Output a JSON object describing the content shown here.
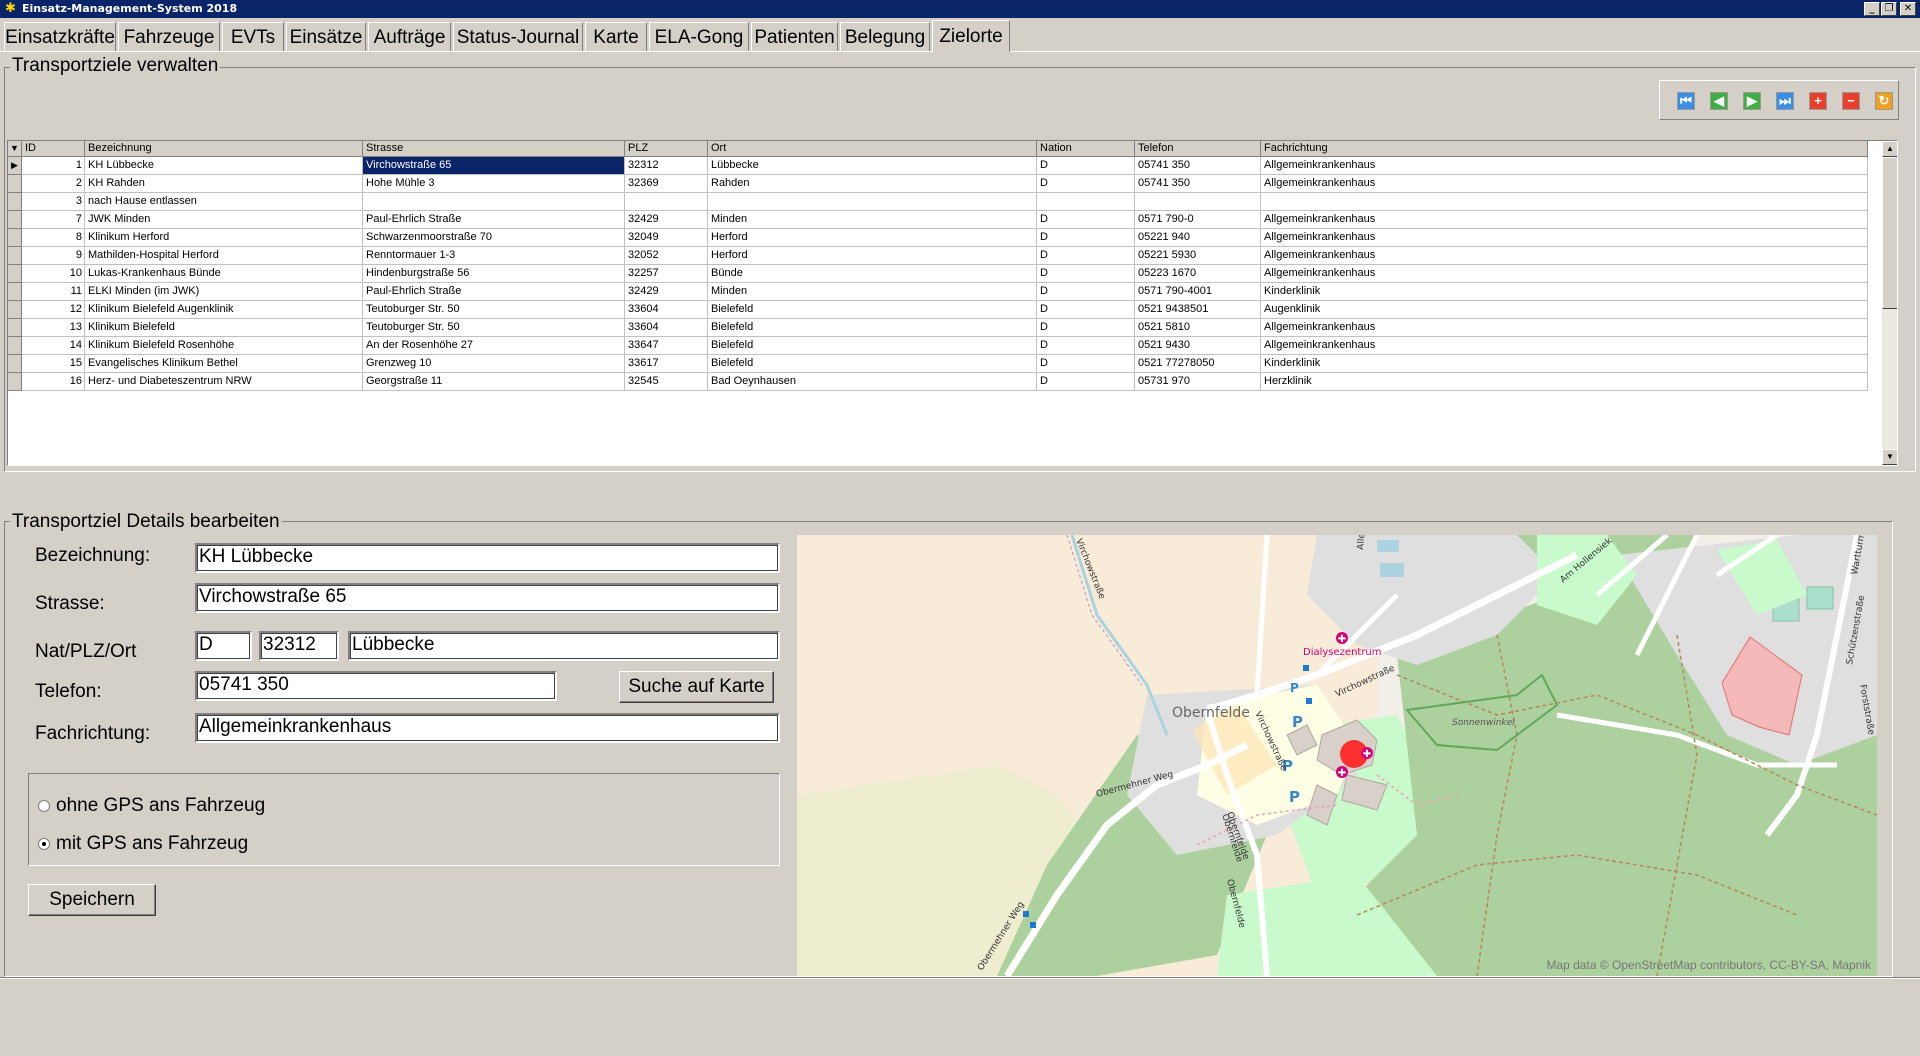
{
  "window": {
    "title": "Einsatz-Management-System 2018"
  },
  "tabs": [
    "Einsatzkräfte",
    "Fahrzeuge",
    "EVTs",
    "Einsätze",
    "Aufträge",
    "Status-Journal",
    "Karte",
    "ELA-Gong",
    "Patienten",
    "Belegung",
    "Zielorte"
  ],
  "active_tab": "Zielorte",
  "list_section": {
    "title": "Transportziele verwalten"
  },
  "grid": {
    "columns": [
      "ID",
      "Bezeichnung",
      "Strasse",
      "PLZ",
      "Ort",
      "Nation",
      "Telefon",
      "Fachrichtung"
    ],
    "rows": [
      {
        "id": "1",
        "name": "KH Lübbecke",
        "street": "Virchowstraße 65",
        "plz": "32312",
        "city": "Lübbecke",
        "nation": "D",
        "phone": "05741 350",
        "dept": "Allgemeinkrankenhaus"
      },
      {
        "id": "2",
        "name": "KH Rahden",
        "street": "Hohe Mühle 3",
        "plz": "32369",
        "city": "Rahden",
        "nation": "D",
        "phone": "05741 350",
        "dept": "Allgemeinkrankenhaus"
      },
      {
        "id": "3",
        "name": "nach Hause entlassen",
        "street": "",
        "plz": "",
        "city": "",
        "nation": "",
        "phone": "",
        "dept": ""
      },
      {
        "id": "7",
        "name": "JWK Minden",
        "street": "Paul-Ehrlich Straße",
        "plz": "32429",
        "city": "Minden",
        "nation": "D",
        "phone": "0571 790-0",
        "dept": "Allgemeinkrankenhaus"
      },
      {
        "id": "8",
        "name": "Klinikum Herford",
        "street": "Schwarzenmoorstraße 70",
        "plz": "32049",
        "city": "Herford",
        "nation": "D",
        "phone": "05221 940",
        "dept": "Allgemeinkrankenhaus"
      },
      {
        "id": "9",
        "name": "Mathilden-Hospital Herford",
        "street": "Renntormauer 1-3",
        "plz": "32052",
        "city": "Herford",
        "nation": "D",
        "phone": "05221 5930",
        "dept": "Allgemeinkrankenhaus"
      },
      {
        "id": "10",
        "name": "Lukas-Krankenhaus Bünde",
        "street": "Hindenburgstraße 56",
        "plz": "32257",
        "city": "Bünde",
        "nation": "D",
        "phone": "05223 1670",
        "dept": "Allgemeinkrankenhaus"
      },
      {
        "id": "11",
        "name": "ELKI Minden (im JWK)",
        "street": "Paul-Ehrlich Straße",
        "plz": "32429",
        "city": "Minden",
        "nation": "D",
        "phone": "0571 790-4001",
        "dept": "Kinderklinik"
      },
      {
        "id": "12",
        "name": "Klinikum Bielefeld Augenklinik",
        "street": "Teutoburger Str. 50",
        "plz": "33604",
        "city": "Bielefeld",
        "nation": "D",
        "phone": "0521 9438501",
        "dept": "Augenklinik"
      },
      {
        "id": "13",
        "name": "Klinikum Bielefeld",
        "street": "Teutoburger Str. 50",
        "plz": "33604",
        "city": "Bielefeld",
        "nation": "D",
        "phone": "0521 5810",
        "dept": "Allgemeinkrankenhaus"
      },
      {
        "id": "14",
        "name": "Klinikum Bielefeld Rosenhöhe",
        "street": "An der Rosenhöhe 27",
        "plz": "33647",
        "city": "Bielefeld",
        "nation": "D",
        "phone": "0521 9430",
        "dept": "Allgemeinkrankenhaus"
      },
      {
        "id": "15",
        "name": "Evangelisches Klinikum Bethel",
        "street": "Grenzweg 10",
        "plz": "33617",
        "city": "Bielefeld",
        "nation": "D",
        "phone": "0521 77278050",
        "dept": "Kinderklinik"
      },
      {
        "id": "16",
        "name": "Herz- und Diabeteszentrum NRW",
        "street": "Georgstraße 11",
        "plz": "32545",
        "city": "Bad Oeynhausen",
        "nation": "D",
        "phone": "05731 970",
        "dept": "Herzklinik"
      }
    ],
    "selected_row": 0
  },
  "detail_section": {
    "title": "Transportziel Details bearbeiten",
    "labels": {
      "name": "Bezeichnung:",
      "street": "Strasse:",
      "nat_plz_city": "Nat/PLZ/Ort",
      "phone": "Telefon:",
      "dept": "Fachrichtung:"
    },
    "values": {
      "name": "KH Lübbecke",
      "street": "Virchowstraße 65",
      "nation": "D",
      "plz": "32312",
      "city": "Lübbecke",
      "phone": "05741 350",
      "dept": "Allgemeinkrankenhaus"
    },
    "search_map_button": "Suche auf Karte",
    "gps_options": [
      {
        "label": "ohne GPS ans Fahrzeug",
        "checked": false
      },
      {
        "label": "mit GPS ans Fahrzeug",
        "checked": true
      }
    ],
    "save_button": "Speichern"
  },
  "map": {
    "labels": {
      "dialysis": "Dialysezentrum",
      "village": "Obernfelde",
      "road1": "Virchowstraße",
      "road1b": "Virchowstraße",
      "road2": "Obermehner Weg",
      "road2b": "Obermehner Weg",
      "road3": "Obernfelde",
      "wood": "Sonnenwinkel",
      "road4": "Am Hollensiek",
      "road5": "Schützenstraße",
      "road6": "Wartturm",
      "road7": "Allee",
      "road8": "Forststraße",
      "road9": "Virchowstraße",
      "road10": "Obernfelde",
      "road11": "Obernfelde",
      "parking": "P"
    },
    "attribution": "Map data © OpenStreetMap contributors, CC-BY-SA, Mapnik"
  },
  "colors": {
    "titlebar": "#0a246a",
    "selection": "#0a246a",
    "nav_blue": "#3a8ee6",
    "nav_green": "#3cb043",
    "nav_red": "#e8402a",
    "nav_orange": "#f0a020",
    "marker": "#ff3030"
  }
}
